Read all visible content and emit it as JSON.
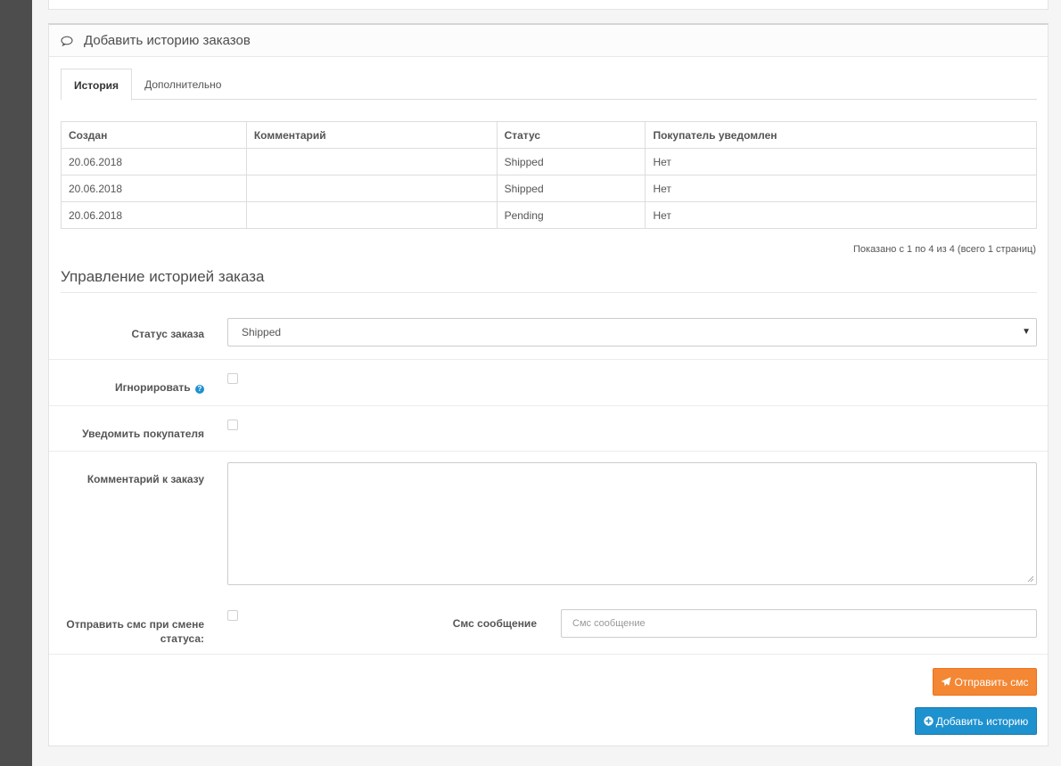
{
  "panel": {
    "title": "Добавить историю заказов"
  },
  "tabs": [
    {
      "label": "История",
      "active": true
    },
    {
      "label": "Дополнительно",
      "active": false
    }
  ],
  "history_table": {
    "columns": [
      "Создан",
      "Комментарий",
      "Статус",
      "Покупатель уведомлен"
    ],
    "rows": [
      [
        "20.06.2018",
        "",
        "Shipped",
        "Нет"
      ],
      [
        "20.06.2018",
        "",
        "Shipped",
        "Нет"
      ],
      [
        "20.06.2018",
        "",
        "Pending",
        "Нет"
      ]
    ],
    "pagination_text": "Показано с 1 по 4 из 4 (всего 1 страниц)"
  },
  "manage": {
    "title": "Управление историей заказа",
    "status_label": "Статус заказа",
    "status_value": "Shipped",
    "ignore_label": "Игнорировать",
    "notify_label": "Уведомить покупателя",
    "comment_label": "Комментарий к заказу",
    "sms_on_change_label_line1": "Отправить смс при смене",
    "sms_on_change_label_line2": "статуса:",
    "sms_message_label": "Смс сообщение",
    "sms_message_placeholder": "Смс сообщение",
    "send_sms_button": "Отправить смс",
    "add_history_button": "Добавить историю"
  },
  "colors": {
    "orange_button": "#f38733",
    "blue_button": "#1e91cf",
    "left_rail": "#4d4d4d"
  }
}
